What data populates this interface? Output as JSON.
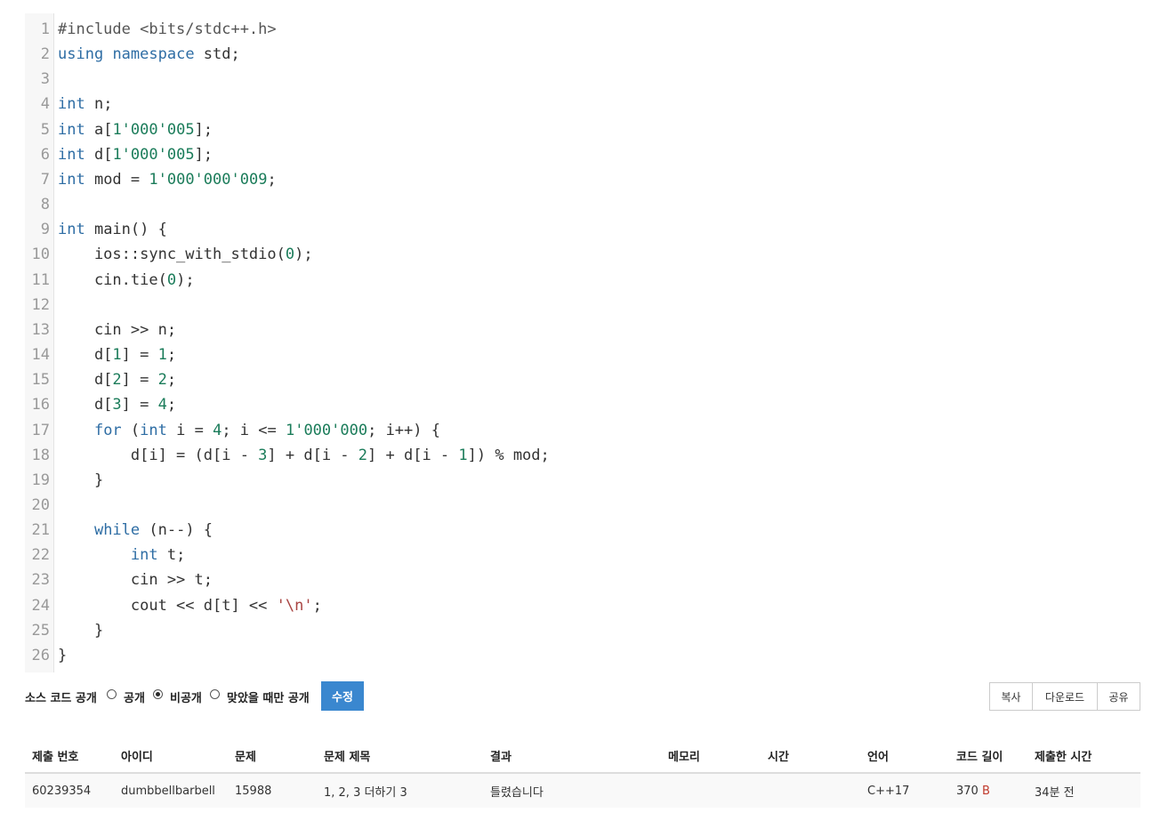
{
  "code": {
    "lines": [
      {
        "n": "1",
        "tokens": [
          [
            "pre",
            "#include <bits/stdc++.h>"
          ]
        ]
      },
      {
        "n": "2",
        "tokens": [
          [
            "kw",
            "using"
          ],
          [
            "punc",
            " "
          ],
          [
            "kw",
            "namespace"
          ],
          [
            "punc",
            " std;"
          ]
        ]
      },
      {
        "n": "3",
        "tokens": []
      },
      {
        "n": "4",
        "tokens": [
          [
            "kw",
            "int"
          ],
          [
            "punc",
            " n;"
          ]
        ]
      },
      {
        "n": "5",
        "tokens": [
          [
            "kw",
            "int"
          ],
          [
            "punc",
            " a["
          ],
          [
            "num",
            "1'000'005"
          ],
          [
            "punc",
            "];"
          ]
        ]
      },
      {
        "n": "6",
        "tokens": [
          [
            "kw",
            "int"
          ],
          [
            "punc",
            " d["
          ],
          [
            "num",
            "1'000'005"
          ],
          [
            "punc",
            "];"
          ]
        ]
      },
      {
        "n": "7",
        "tokens": [
          [
            "kw",
            "int"
          ],
          [
            "punc",
            " mod = "
          ],
          [
            "num",
            "1'000'000'009"
          ],
          [
            "punc",
            ";"
          ]
        ]
      },
      {
        "n": "8",
        "tokens": []
      },
      {
        "n": "9",
        "tokens": [
          [
            "kw",
            "int"
          ],
          [
            "punc",
            " main() {"
          ]
        ]
      },
      {
        "n": "10",
        "tokens": [
          [
            "punc",
            "    ios::sync_with_stdio("
          ],
          [
            "num",
            "0"
          ],
          [
            "punc",
            ");"
          ]
        ]
      },
      {
        "n": "11",
        "tokens": [
          [
            "punc",
            "    cin.tie("
          ],
          [
            "num",
            "0"
          ],
          [
            "punc",
            ");"
          ]
        ]
      },
      {
        "n": "12",
        "tokens": []
      },
      {
        "n": "13",
        "tokens": [
          [
            "punc",
            "    cin >> n;"
          ]
        ]
      },
      {
        "n": "14",
        "tokens": [
          [
            "punc",
            "    d["
          ],
          [
            "num",
            "1"
          ],
          [
            "punc",
            "] = "
          ],
          [
            "num",
            "1"
          ],
          [
            "punc",
            ";"
          ]
        ]
      },
      {
        "n": "15",
        "tokens": [
          [
            "punc",
            "    d["
          ],
          [
            "num",
            "2"
          ],
          [
            "punc",
            "] = "
          ],
          [
            "num",
            "2"
          ],
          [
            "punc",
            ";"
          ]
        ]
      },
      {
        "n": "16",
        "tokens": [
          [
            "punc",
            "    d["
          ],
          [
            "num",
            "3"
          ],
          [
            "punc",
            "] = "
          ],
          [
            "num",
            "4"
          ],
          [
            "punc",
            ";"
          ]
        ]
      },
      {
        "n": "17",
        "tokens": [
          [
            "punc",
            "    "
          ],
          [
            "kw",
            "for"
          ],
          [
            "punc",
            " ("
          ],
          [
            "kw",
            "int"
          ],
          [
            "punc",
            " i = "
          ],
          [
            "num",
            "4"
          ],
          [
            "punc",
            "; i <= "
          ],
          [
            "num",
            "1'000'000"
          ],
          [
            "punc",
            "; i++) {"
          ]
        ]
      },
      {
        "n": "18",
        "tokens": [
          [
            "punc",
            "        d[i] = (d[i - "
          ],
          [
            "num",
            "3"
          ],
          [
            "punc",
            "] + d[i - "
          ],
          [
            "num",
            "2"
          ],
          [
            "punc",
            "] + d[i - "
          ],
          [
            "num",
            "1"
          ],
          [
            "punc",
            "]) % mod;"
          ]
        ]
      },
      {
        "n": "19",
        "tokens": [
          [
            "punc",
            "    }"
          ]
        ]
      },
      {
        "n": "20",
        "tokens": []
      },
      {
        "n": "21",
        "tokens": [
          [
            "punc",
            "    "
          ],
          [
            "kw",
            "while"
          ],
          [
            "punc",
            " (n--) {"
          ]
        ]
      },
      {
        "n": "22",
        "tokens": [
          [
            "punc",
            "        "
          ],
          [
            "kw",
            "int"
          ],
          [
            "punc",
            " t;"
          ]
        ]
      },
      {
        "n": "23",
        "tokens": [
          [
            "punc",
            "        cin >> t;"
          ]
        ]
      },
      {
        "n": "24",
        "tokens": [
          [
            "punc",
            "        cout << d[t] << "
          ],
          [
            "str",
            "'\\n'"
          ],
          [
            "punc",
            ";"
          ]
        ]
      },
      {
        "n": "25",
        "tokens": [
          [
            "punc",
            "    }"
          ]
        ]
      },
      {
        "n": "26",
        "tokens": [
          [
            "punc",
            "}"
          ]
        ]
      }
    ]
  },
  "visibility": {
    "label": "소스 코드 공개",
    "options": [
      {
        "label": "공개",
        "checked": false
      },
      {
        "label": "비공개",
        "checked": true
      },
      {
        "label": "맞았을 때만 공개",
        "checked": false
      }
    ],
    "save_label": "수정"
  },
  "actions": {
    "copy": "복사",
    "download": "다운로드",
    "share": "공유"
  },
  "table": {
    "headers": [
      "제출 번호",
      "아이디",
      "문제",
      "문제 제목",
      "결과",
      "메모리",
      "시간",
      "언어",
      "코드 길이",
      "제출한 시간"
    ],
    "row": {
      "submission_id": "60239354",
      "user": "dumbbellbarbell",
      "problem": "15988",
      "problem_title": "1, 2, 3 더하기 3",
      "result": "틀렸습니다",
      "memory": "",
      "time": "",
      "language": "C++17",
      "code_length": "370",
      "code_length_unit": "B",
      "submitted": "34분 전"
    }
  },
  "colors": {
    "accent": "#3a87cf",
    "link": "#2e6da4",
    "wrong": "#c0392b"
  }
}
